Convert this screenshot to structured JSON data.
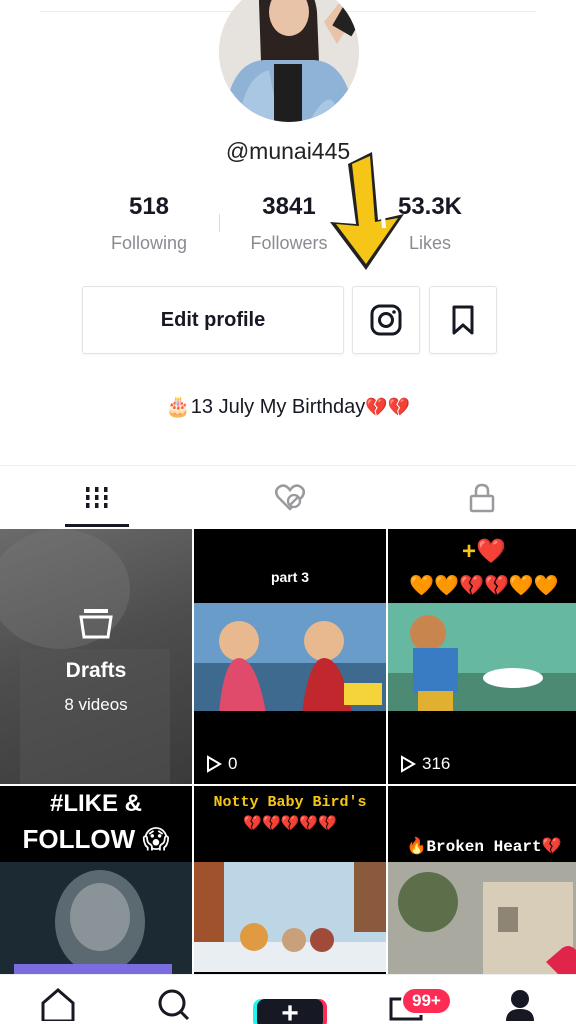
{
  "profile": {
    "username": "@munai445",
    "stats": [
      {
        "value": "518",
        "label": "Following"
      },
      {
        "value": "3841",
        "label": "Followers"
      },
      {
        "value": "53.3K",
        "label": "Likes"
      }
    ],
    "edit_button": "Edit profile",
    "bio_text": "13 July My Birthday",
    "bio_emoji": "🎂",
    "bio_hearts": "💔💔"
  },
  "tabs": [
    "videos-grid-icon",
    "liked-icon",
    "private-lock-icon"
  ],
  "grid": {
    "drafts": {
      "title": "Drafts",
      "count": "8 videos"
    },
    "videos": [
      {
        "caption": "part 3",
        "views": "0"
      },
      {
        "caption": "+❤️",
        "views": "316",
        "hearts": "🧡🧡💔💔🧡🧡"
      },
      {
        "caption_line1": "#LIKE &",
        "caption_line2": "FOLLOW 😱"
      },
      {
        "caption": "Notty Baby Bird's",
        "hearts": "💔💔💔💔💔"
      },
      {
        "caption": "🔥Broken Heart💔"
      }
    ]
  },
  "nav": {
    "items": [
      "home-icon",
      "discover-icon",
      "create-icon",
      "inbox-icon",
      "profile-icon"
    ],
    "inbox_badge": "99+"
  },
  "colors": {
    "accent": "#fe2c55",
    "cyan": "#25f4ee",
    "arrow": "#f5c518"
  }
}
